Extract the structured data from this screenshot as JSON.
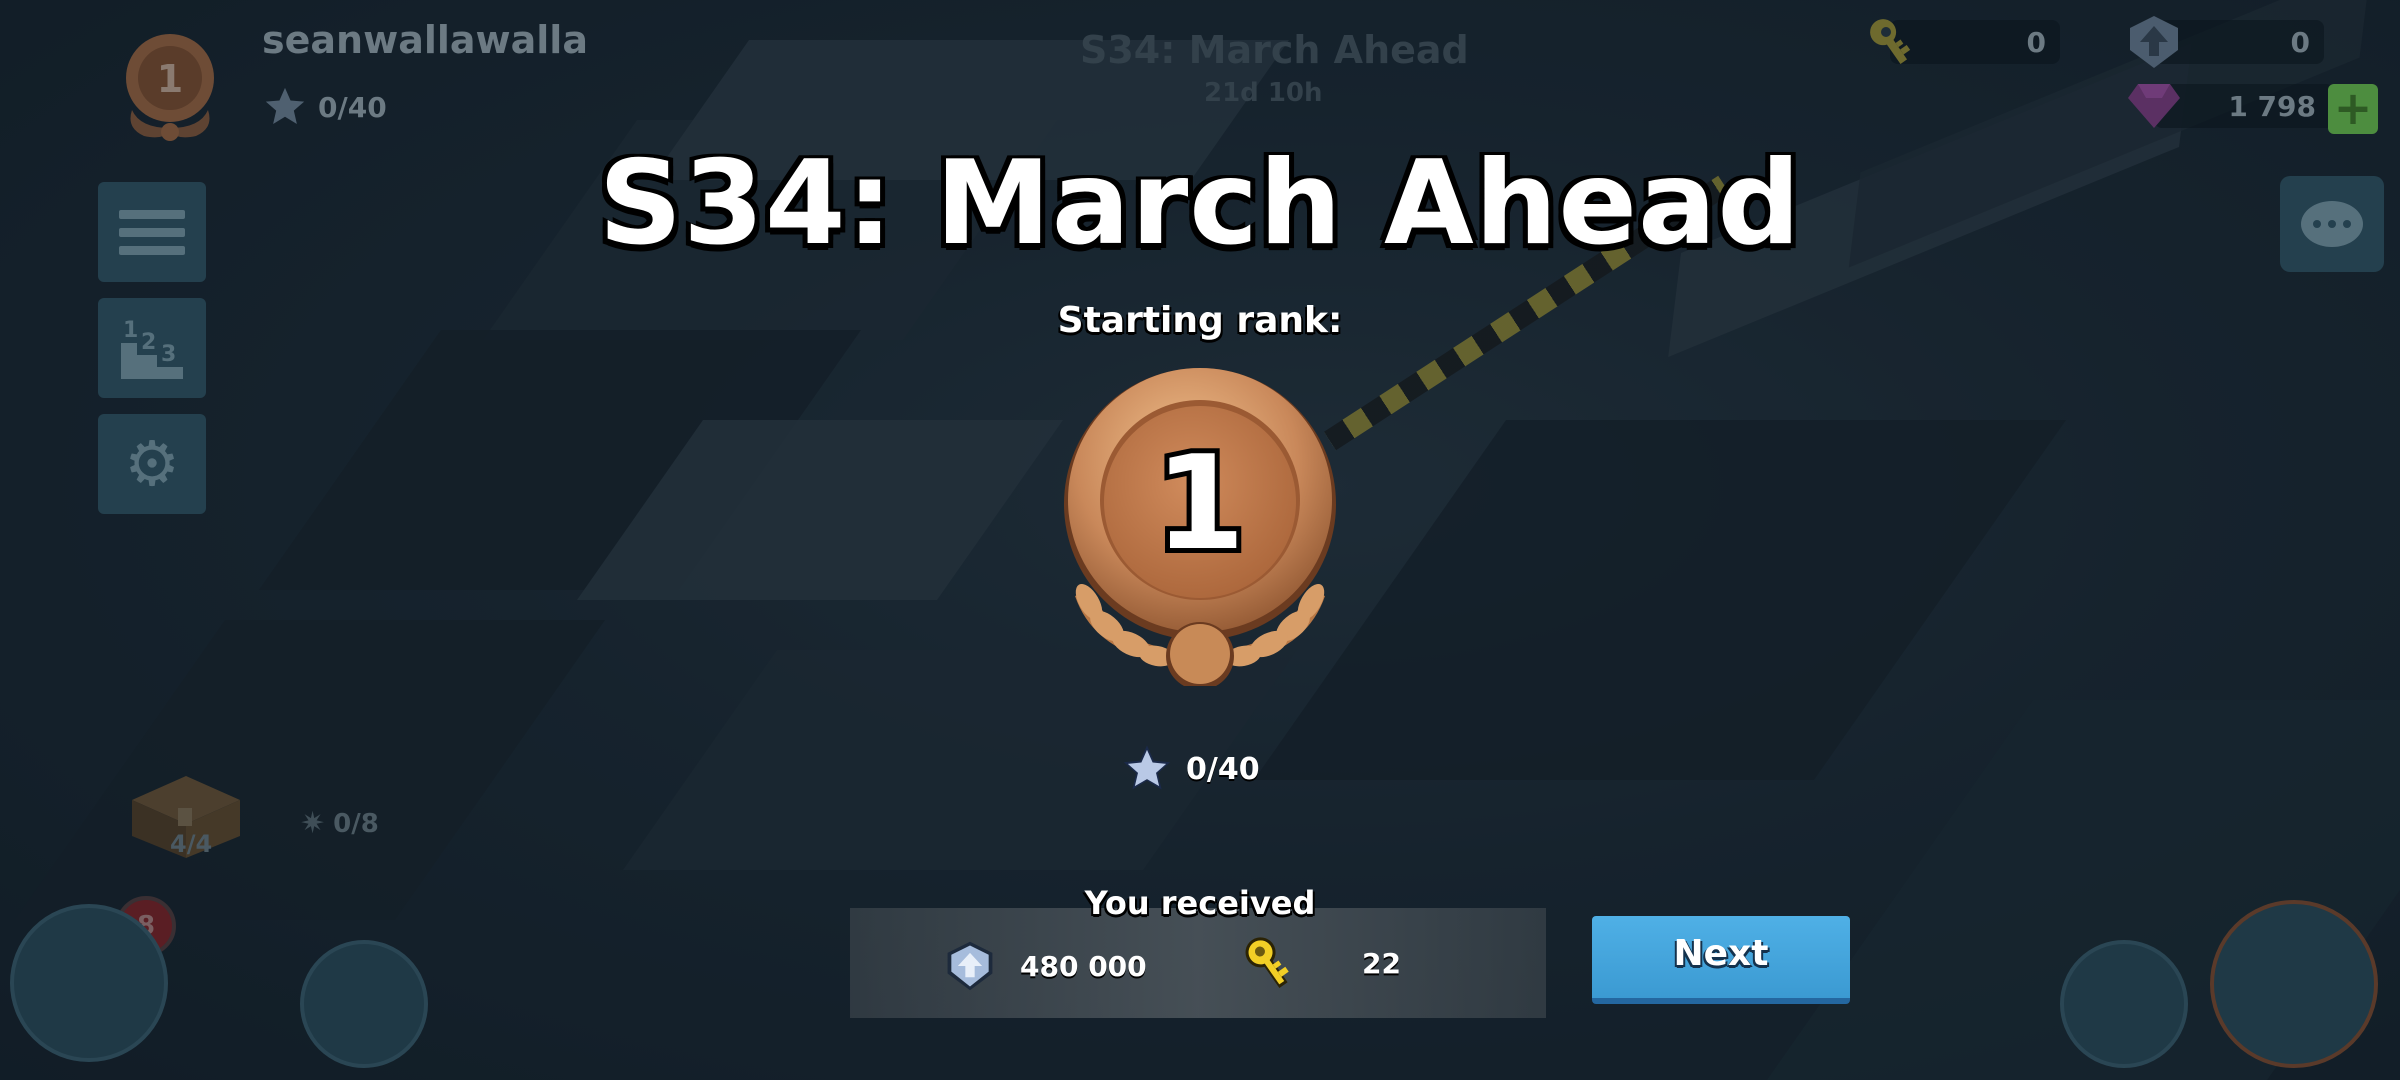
{
  "player": {
    "name": "seanwallawalla",
    "rank": "1",
    "stars": "0/40"
  },
  "resources": {
    "keys": "0",
    "intel": "0",
    "diamonds": "1 798"
  },
  "background_event": {
    "title": "S34: March Ahead",
    "timer": "21d 10h"
  },
  "hud": {
    "chest_progress": "4/4",
    "building_count": "0/8",
    "badge_count": "8"
  },
  "dialog": {
    "title": "S34: March Ahead",
    "starting_rank_label": "Starting rank:",
    "rank_number": "1",
    "stars": "0/40",
    "received_label": "You received",
    "rewards": [
      {
        "icon": "intel-icon",
        "amount": "480 000"
      },
      {
        "icon": "key-icon",
        "amount": "22"
      }
    ],
    "next_label": "Next"
  },
  "colors": {
    "bronze": "#c88a57",
    "bronze_dark": "#8f5631",
    "next_button": "#44a6de",
    "key_yellow": "#e9c41d",
    "intel_blue": "#9fb6d6"
  }
}
